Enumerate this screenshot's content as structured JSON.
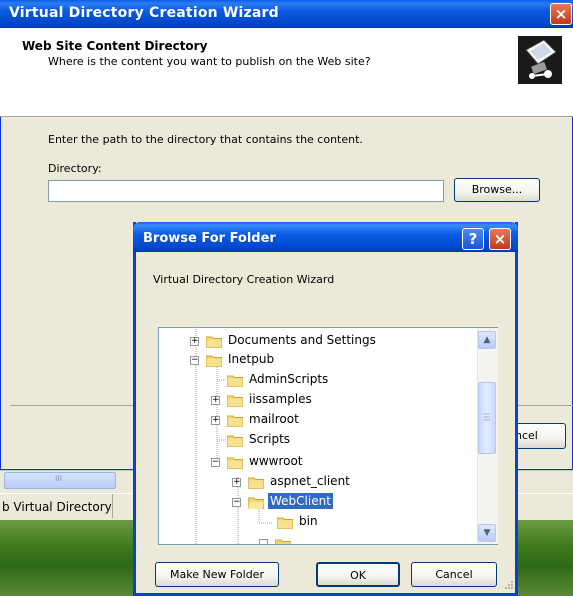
{
  "wizard": {
    "title": "Virtual Directory Creation Wizard",
    "close_label": "×",
    "header_title": "Web Site Content Directory",
    "header_subtitle": "Where is the content you want to publish on the Web site?",
    "instruction": "Enter the path to the directory that contains the content.",
    "directory_label": "Directory:",
    "directory_value": "",
    "browse_label": "Browse...",
    "cancel_partial": "ncel"
  },
  "taskbar": {
    "scroll_grip": "III",
    "item_label": "b Virtual Directory"
  },
  "browse_dialog": {
    "title": "Browse For Folder",
    "help_label": "?",
    "close_label": "×",
    "description": "Virtual Directory Creation Wizard",
    "make_new_folder": "Make New Folder",
    "ok": "OK",
    "cancel": "Cancel",
    "tree": [
      {
        "label": "Documents and Settings",
        "expander": "+",
        "selected": false
      },
      {
        "label": "Inetpub",
        "expander": "−",
        "selected": false
      },
      {
        "label": "AdminScripts",
        "expander": "",
        "selected": false
      },
      {
        "label": "iissamples",
        "expander": "+",
        "selected": false
      },
      {
        "label": "mailroot",
        "expander": "+",
        "selected": false
      },
      {
        "label": "Scripts",
        "expander": "",
        "selected": false
      },
      {
        "label": "wwwroot",
        "expander": "−",
        "selected": false
      },
      {
        "label": "aspnet_client",
        "expander": "+",
        "selected": false
      },
      {
        "label": "WebClient",
        "expander": "−",
        "selected": true
      },
      {
        "label": "bin",
        "expander": "",
        "selected": false
      }
    ]
  },
  "colors": {
    "title_blue": "#0a5ce6",
    "selection": "#316ac5",
    "dialog_face": "#ece9d8"
  }
}
